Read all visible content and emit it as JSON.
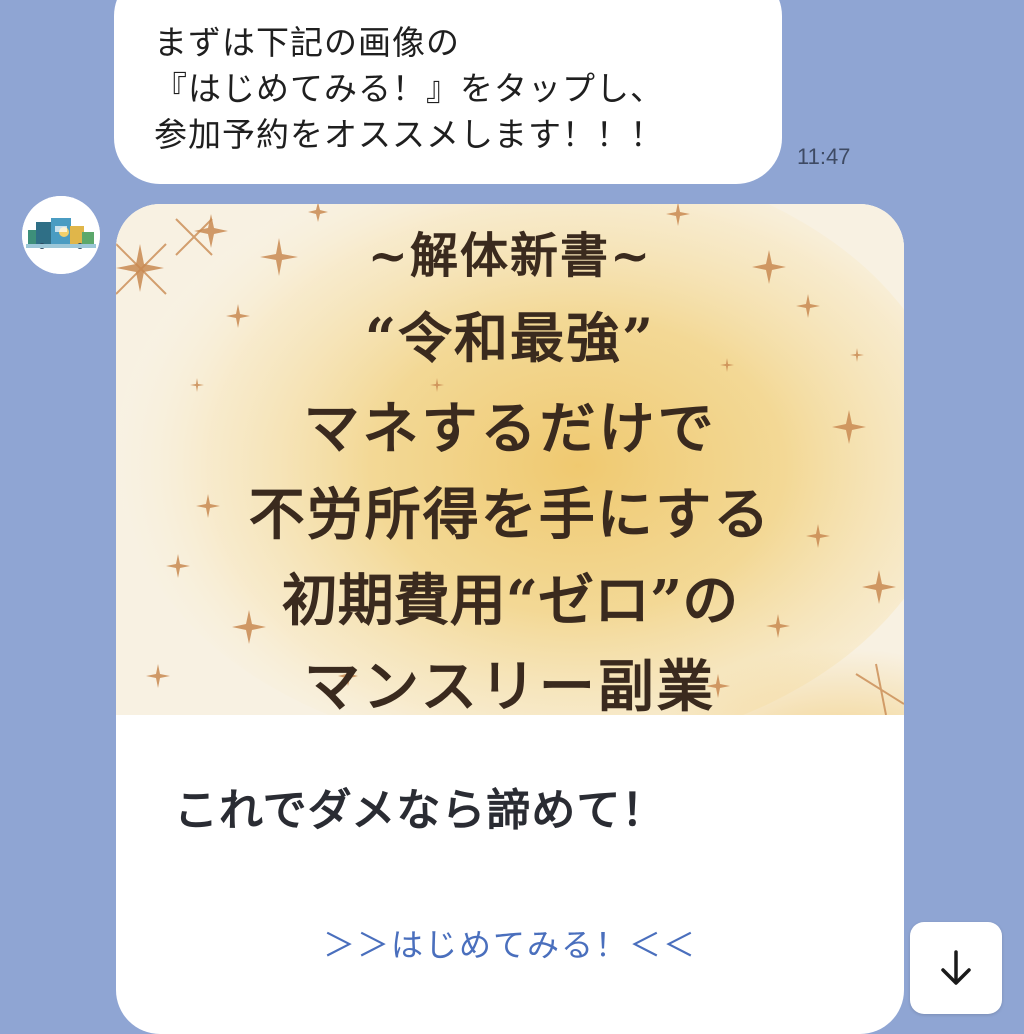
{
  "message": {
    "lines": [
      "まずは下記の画像の",
      "『はじめてみる！』をタップし、",
      "参加予約をオススメします！！！"
    ],
    "time": "11:47"
  },
  "avatar_icon": "bot-avatar-icon",
  "card": {
    "image_lines": [
      "~解体新書~",
      "“令和最強”",
      "マネするだけで",
      "不労所得を手にする",
      "初期費用“ゼロ”の",
      "マンスリー副業"
    ],
    "title": "これでダメなら諦めて！",
    "action_label": "＞＞はじめてみる！＜＜"
  },
  "scroll_button": {
    "icon": "arrow-down-icon"
  },
  "colors": {
    "background": "#8fa5d3",
    "bubble": "#ffffff",
    "link": "#4a6fbd",
    "image_text": "#3a2a1e",
    "image_wash": "#f0cf78"
  }
}
